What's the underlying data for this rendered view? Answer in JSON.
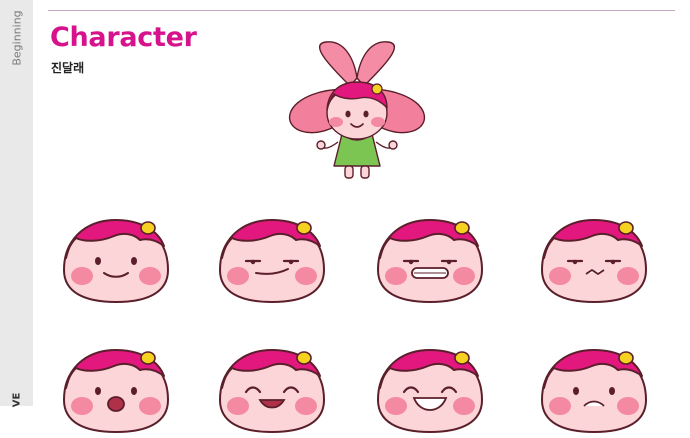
{
  "sidebar": {
    "section_label": "Beginning",
    "bottom_label": "VE"
  },
  "header": {
    "title": "Character",
    "subtitle": "진달래"
  },
  "colors": {
    "accent": "#d6138d",
    "skin": "#fcd5d9",
    "hair": "#e2187f",
    "blush": "#f48aa2",
    "petal": "#f27f9b",
    "dress": "#7cc552",
    "outline": "#5a1f2a",
    "clip": "#f4d21f"
  },
  "faces": [
    {
      "expression": "smile"
    },
    {
      "expression": "smirk"
    },
    {
      "expression": "grin"
    },
    {
      "expression": "annoyed"
    },
    {
      "expression": "open-mouth"
    },
    {
      "expression": "laugh"
    },
    {
      "expression": "big-laugh"
    },
    {
      "expression": "upset"
    }
  ]
}
